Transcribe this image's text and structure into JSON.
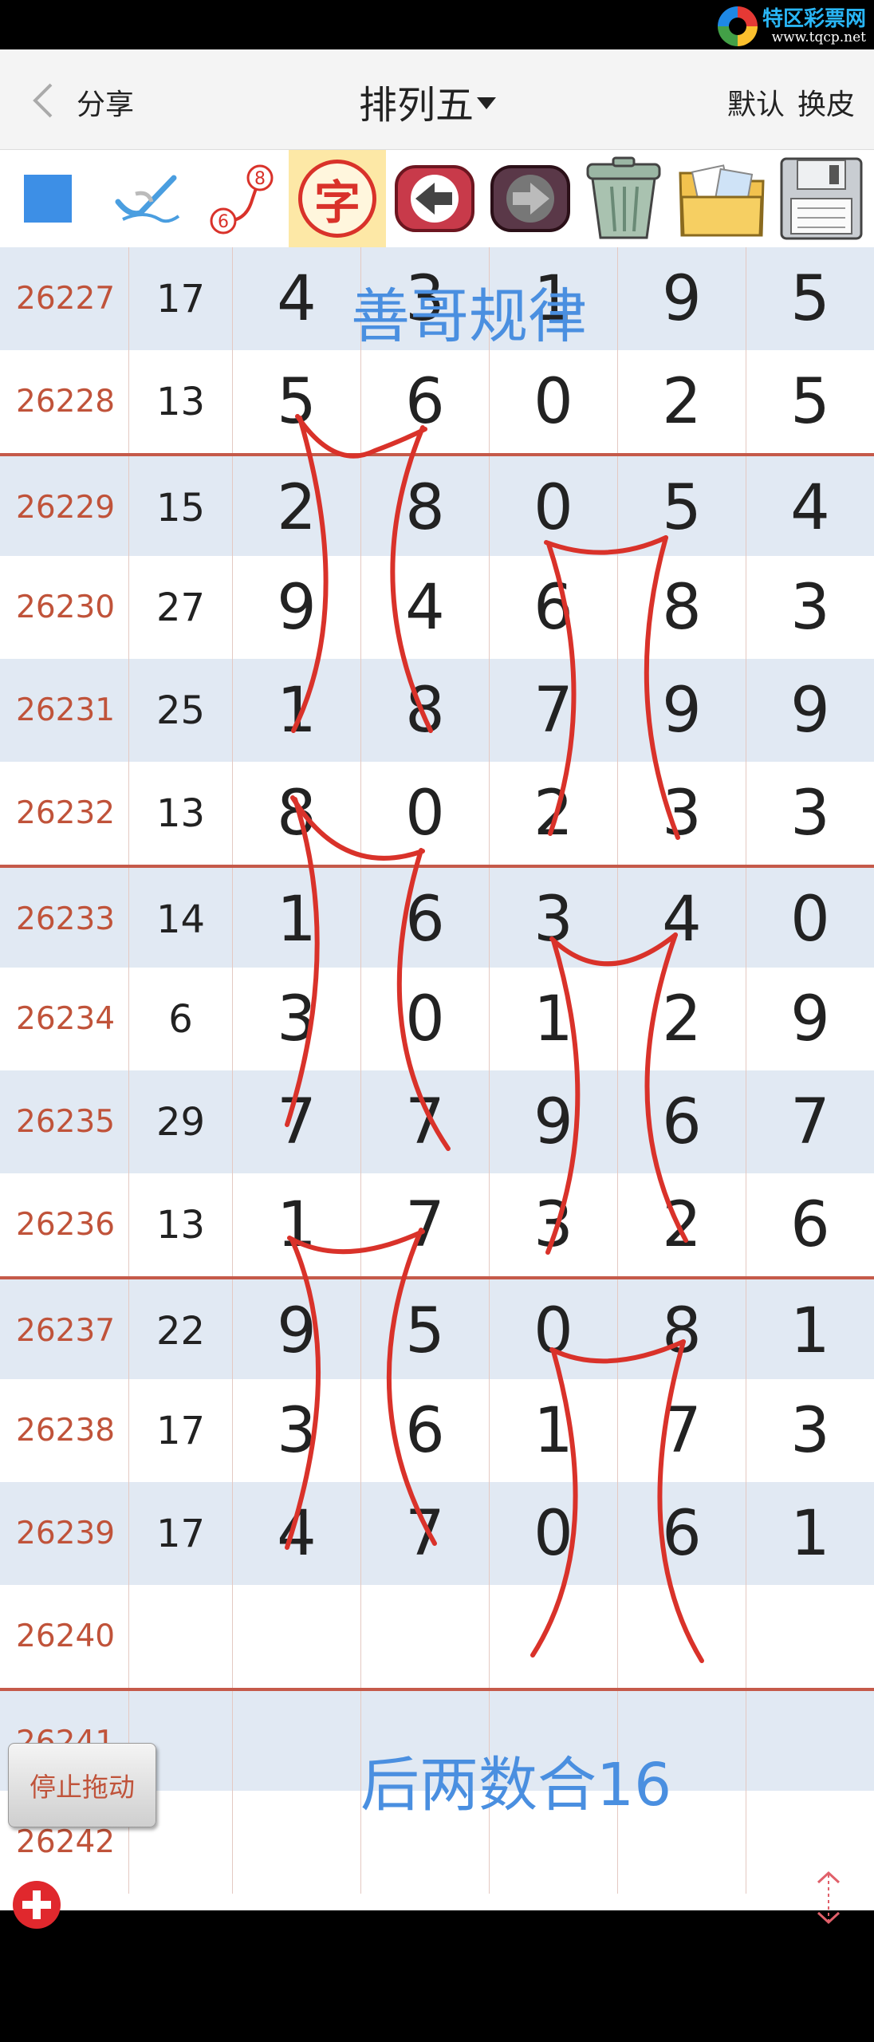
{
  "watermark": {
    "title": "特区彩票网",
    "url": "www.tqcp.net"
  },
  "header": {
    "share_label": "分享",
    "title": "排列五",
    "default_label": "默认",
    "skin_label": "换皮"
  },
  "toolbar": {
    "tools": [
      {
        "icon": "blue-square-icon"
      },
      {
        "icon": "pen-check-icon"
      },
      {
        "icon": "curve-link-icon",
        "from": "6",
        "to": "8"
      },
      {
        "icon": "zi-character-icon",
        "label": "字"
      },
      {
        "icon": "back-arrow-icon"
      },
      {
        "icon": "forward-arrow-icon"
      },
      {
        "icon": "trash-can-icon"
      },
      {
        "icon": "photos-folder-icon"
      },
      {
        "icon": "floppy-disk-icon"
      }
    ]
  },
  "rows": [
    {
      "issue": "26227",
      "sum": "17",
      "digits": [
        "4",
        "3",
        "1",
        "9",
        "5"
      ]
    },
    {
      "issue": "26228",
      "sum": "13",
      "digits": [
        "5",
        "6",
        "0",
        "2",
        "5"
      ]
    },
    {
      "issue": "26229",
      "sum": "15",
      "digits": [
        "2",
        "8",
        "0",
        "5",
        "4"
      ]
    },
    {
      "issue": "26230",
      "sum": "27",
      "digits": [
        "9",
        "4",
        "6",
        "8",
        "3"
      ]
    },
    {
      "issue": "26231",
      "sum": "25",
      "digits": [
        "1",
        "8",
        "7",
        "9",
        "9"
      ]
    },
    {
      "issue": "26232",
      "sum": "13",
      "digits": [
        "8",
        "0",
        "2",
        "3",
        "3"
      ]
    },
    {
      "issue": "26233",
      "sum": "14",
      "digits": [
        "1",
        "6",
        "3",
        "4",
        "0"
      ]
    },
    {
      "issue": "26234",
      "sum": "6",
      "digits": [
        "3",
        "0",
        "1",
        "2",
        "9"
      ]
    },
    {
      "issue": "26235",
      "sum": "29",
      "digits": [
        "7",
        "7",
        "9",
        "6",
        "7"
      ]
    },
    {
      "issue": "26236",
      "sum": "13",
      "digits": [
        "1",
        "7",
        "3",
        "2",
        "6"
      ]
    },
    {
      "issue": "26237",
      "sum": "22",
      "digits": [
        "9",
        "5",
        "0",
        "8",
        "1"
      ]
    },
    {
      "issue": "26238",
      "sum": "17",
      "digits": [
        "3",
        "6",
        "1",
        "7",
        "3"
      ]
    },
    {
      "issue": "26239",
      "sum": "17",
      "digits": [
        "4",
        "7",
        "0",
        "6",
        "1"
      ]
    },
    {
      "issue": "26240",
      "sum": "",
      "digits": [
        "",
        "",
        "",
        "",
        ""
      ]
    },
    {
      "issue": "26241",
      "sum": "",
      "digits": [
        "",
        "",
        "",
        "",
        ""
      ]
    },
    {
      "issue": "26242",
      "sum": "",
      "digits": [
        "",
        "",
        "",
        "",
        ""
      ]
    }
  ],
  "annotations": {
    "top": "善哥规律",
    "bottom": "后两数合16"
  },
  "stop_drag_label": "停止拖动",
  "colors": {
    "issue": "#c0533a",
    "separator": "#c55a4a",
    "alt_row": "#e1e9f3",
    "stroke": "#d9322a",
    "annotation": "#4a8fe0"
  }
}
